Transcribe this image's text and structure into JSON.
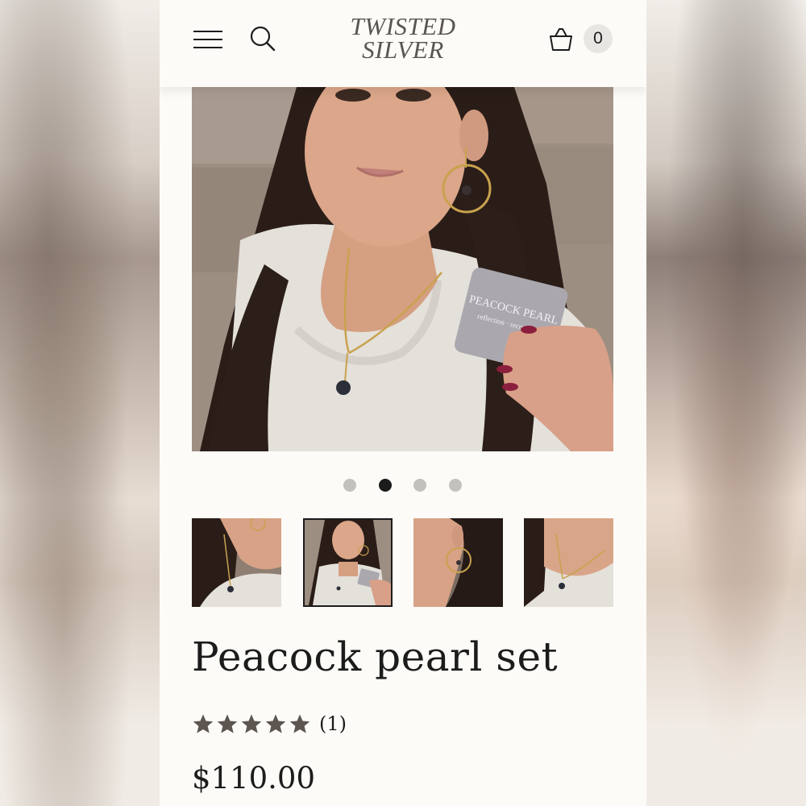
{
  "header": {
    "logo_line1": "TWISTED",
    "logo_line2": "SILVER",
    "cart_count": "0",
    "icons": [
      "hamburger-menu-icon",
      "search-icon",
      "shopping-basket-icon"
    ]
  },
  "gallery": {
    "slide_count": 4,
    "active_slide": 2,
    "card_text": {
      "line1": "PEACOCK PEARL",
      "line2": "reflection · recognition"
    },
    "thumbnails_count": 4,
    "selected_thumbnail": 2
  },
  "product": {
    "title": "Peacock pearl set",
    "rating_stars": 5,
    "review_count": "(1)",
    "price": "$110.00"
  },
  "colors": {
    "background": "#fdfbf7",
    "text": "#1c1c1c",
    "star": "#5c5550",
    "logo": "#5a5550",
    "dot_active": "#1c1c1c",
    "dot_inactive": "#c3c1bd"
  }
}
